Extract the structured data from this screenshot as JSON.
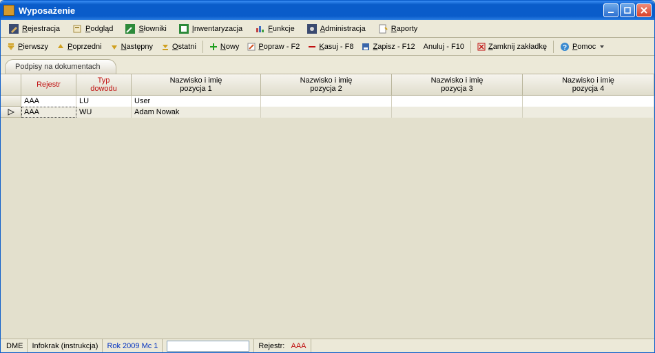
{
  "window": {
    "title": "Wyposażenie"
  },
  "menubar": {
    "items": [
      {
        "label": "Rejestracja",
        "icon": "pen-icon",
        "hotkey": 0
      },
      {
        "label": "Podgląd",
        "icon": "preview-icon",
        "hotkey": 0
      },
      {
        "label": "Słowniki",
        "icon": "book-icon",
        "hotkey": 0
      },
      {
        "label": "Inwentaryzacja",
        "icon": "inventory-icon",
        "hotkey": 0
      },
      {
        "label": "Funkcje",
        "icon": "functions-icon",
        "hotkey": 0
      },
      {
        "label": "Administracja",
        "icon": "admin-icon",
        "hotkey": 0
      },
      {
        "label": "Raporty",
        "icon": "report-icon",
        "hotkey": 0
      }
    ]
  },
  "toolbar": {
    "first": {
      "label": "Pierwszy",
      "icon": "arrow-first-icon"
    },
    "prev": {
      "label": "Poprzedni",
      "icon": "arrow-up-icon"
    },
    "next": {
      "label": "Następny",
      "icon": "arrow-down-icon"
    },
    "last": {
      "label": "Ostatni",
      "icon": "arrow-last-icon"
    },
    "new": {
      "label": "Nowy",
      "icon": "plus-icon"
    },
    "edit": {
      "label": "Popraw - F2",
      "icon": "edit-icon"
    },
    "delete": {
      "label": "Kasuj - F8",
      "icon": "minus-icon"
    },
    "save": {
      "label": "Zapisz - F12",
      "icon": "save-icon"
    },
    "cancel": {
      "label": "Anuluj - F10",
      "icon": ""
    },
    "closetab": {
      "label": "Zamknij zakładkę",
      "icon": "close-tab-icon"
    },
    "help": {
      "label": "Pomoc",
      "icon": "help-icon"
    }
  },
  "tab": {
    "label": "Podpisy na dokumentach"
  },
  "grid": {
    "columns": [
      {
        "line1": "",
        "line2": ""
      },
      {
        "line1": "Rejestr",
        "line2": "",
        "red": true
      },
      {
        "line1": "Typ",
        "line2": "dowodu",
        "red": true
      },
      {
        "line1": "Nazwisko i imię",
        "line2": "pozycja 1"
      },
      {
        "line1": "Nazwisko i imię",
        "line2": "pozycja 2"
      },
      {
        "line1": "Nazwisko i imię",
        "line2": "pozycja 3"
      },
      {
        "line1": "Nazwisko i imię",
        "line2": "pozycja 4"
      }
    ],
    "rows": [
      {
        "current": false,
        "rejestr": "AAA",
        "typ": "LU",
        "p1": "User",
        "p2": "",
        "p3": "",
        "p4": ""
      },
      {
        "current": true,
        "rejestr": "AAA",
        "typ": "WU",
        "p1": "Adam Nowak",
        "p2": "",
        "p3": "",
        "p4": ""
      }
    ]
  },
  "status": {
    "seg1": "DME",
    "seg2": "Infokrak (instrukcja)",
    "seg3": "Rok 2009  Mc 1",
    "input": "",
    "seg5_label": "Rejestr:",
    "seg5_value": "AAA"
  }
}
